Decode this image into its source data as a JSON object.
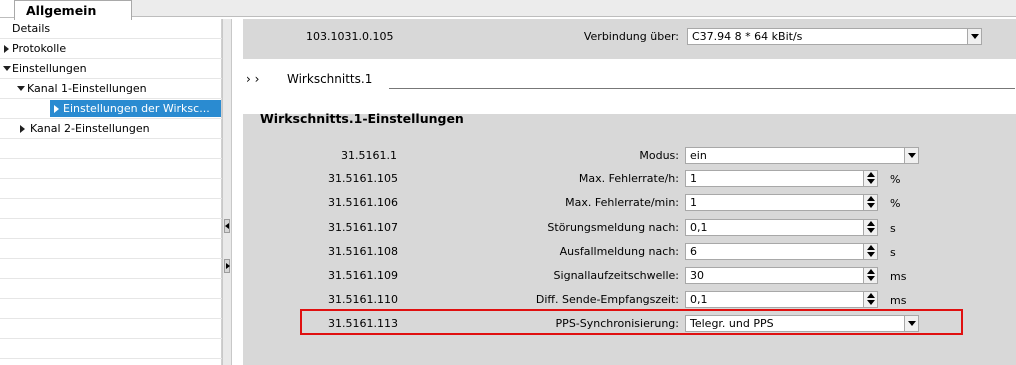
{
  "tabs": {
    "active": "Allgemein"
  },
  "tree": {
    "items": [
      {
        "label": "Details",
        "expander": "none",
        "indent": 0
      },
      {
        "label": "Protokolle",
        "expander": "collapsed",
        "indent": 0
      },
      {
        "label": "Einstellungen",
        "expander": "expanded",
        "indent": 0
      },
      {
        "label": "Kanal 1-Einstellungen",
        "expander": "expanded",
        "indent": 1
      },
      {
        "label": "Einstellungen der Wirksc...",
        "expander": "collapsed",
        "indent": 2,
        "selected": true
      },
      {
        "label": "Kanal 2-Einstellungen",
        "expander": "collapsed",
        "indent": 1
      }
    ]
  },
  "top_row": {
    "address": "103.1031.0.105",
    "label": "Verbindung über:",
    "value": "C37.94 8 * 64 kBit/s"
  },
  "breadcrumb": {
    "arrows": "› ›",
    "text": "Wirkschnitts.1"
  },
  "section": {
    "title": "Wirkschnitts.1-Einstellungen",
    "rows": [
      {
        "address": "31.5161.1",
        "label": "Modus:",
        "value": "ein",
        "control": "dropdown",
        "unit": ""
      },
      {
        "address": "31.5161.105",
        "label": "Max. Fehlerrate/h:",
        "value": "1",
        "control": "spinner",
        "unit": "%"
      },
      {
        "address": "31.5161.106",
        "label": "Max. Fehlerrate/min:",
        "value": "1",
        "control": "spinner",
        "unit": "%"
      },
      {
        "address": "31.5161.107",
        "label": "Störungsmeldung nach:",
        "value": "0,1",
        "control": "spinner",
        "unit": "s"
      },
      {
        "address": "31.5161.108",
        "label": "Ausfallmeldung nach:",
        "value": "6",
        "control": "spinner",
        "unit": "s"
      },
      {
        "address": "31.5161.109",
        "label": "Signallaufzeitschwelle:",
        "value": "30",
        "control": "spinner",
        "unit": "ms"
      },
      {
        "address": "31.5161.110",
        "label": "Diff. Sende-Empfangszeit:",
        "value": "0,1",
        "control": "spinner",
        "unit": "ms"
      },
      {
        "address": "31.5161.113",
        "label": "PPS-Synchronisierung:",
        "value": "Telegr. und PPS",
        "control": "dropdown",
        "unit": "",
        "highlighted": true
      }
    ]
  },
  "colors": {
    "selection": "#2a8bd1",
    "panel": "#d8d8d8",
    "highlight_border": "#e01010"
  }
}
